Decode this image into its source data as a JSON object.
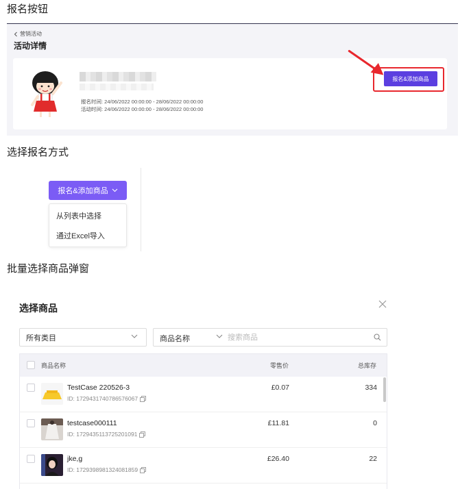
{
  "sections": {
    "s1": "报名按钮",
    "s2": "选择报名方式",
    "s3": "批量选择商品弹窗"
  },
  "activity": {
    "back_label": "营销活动",
    "title": "活动详情",
    "signup_time": "报名时间: 24/06/2022 00:00:00 - 28/06/2022 00:00:00",
    "activity_time": "活动时间: 24/06/2022 00:00:00 - 28/06/2022 00:00:00",
    "signup_button": "报名&添加商品",
    "highlight_color": "#e8272d",
    "button_color": "#5b3fe0"
  },
  "signup_method": {
    "dropdown_label": "报名&添加商品",
    "options": [
      "从列表中选择",
      "通过Excel导入"
    ],
    "accent_color": "#7b5cf5"
  },
  "modal": {
    "title": "选择商品",
    "category_select": "所有类目",
    "search_type": "商品名称",
    "search_placeholder": "搜索商品",
    "columns": [
      "商品名称",
      "零售价",
      "总库存"
    ],
    "rows": [
      {
        "name": "TestCase 220526-3",
        "id": "ID: 1729431740786576067",
        "price": "£0.07",
        "stock": "334",
        "thumb": "yellow-skirt"
      },
      {
        "name": "testcase000111",
        "id": "ID: 1729435113725201091",
        "price": "£11.81",
        "stock": "0",
        "thumb": "white-dress"
      },
      {
        "name": "jke,g",
        "id": "ID: 1729398981324081859",
        "price": "£26.40",
        "stock": "22",
        "thumb": "portrait"
      }
    ]
  }
}
